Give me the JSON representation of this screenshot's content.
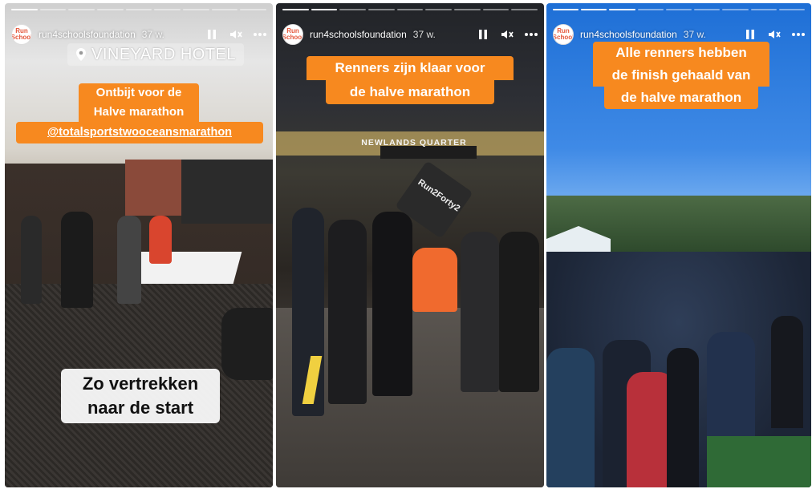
{
  "colors": {
    "caption_bg": "#f7891f",
    "caption_text": "#ffffff",
    "progress_active": "#ffffff"
  },
  "stories": [
    {
      "username": "run4schoolsfoundation",
      "time_ago": "37 w.",
      "avatar_text": "Run 4Schools",
      "progress": {
        "total": 9,
        "current": 1
      },
      "location_sticker": "VINEYARD HOTEL",
      "caption_lines": [
        "Ontbijt voor de",
        "Halve marathon",
        "@totalsportstwooceansmarathon"
      ],
      "bottom_caption_lines": [
        "Zo vertrekken",
        "naar de start"
      ],
      "icons": [
        "pause-icon",
        "volume-muted-icon",
        "more-icon"
      ]
    },
    {
      "username": "run4schoolsfoundation",
      "time_ago": "37 w.",
      "avatar_text": "Run 4Schools",
      "progress": {
        "total": 9,
        "current": 2
      },
      "caption_lines": [
        "Renners zijn klaar voor",
        "de halve marathon"
      ],
      "sign_text": "NEWLANDS QUARTER",
      "banner_text": "Run2Forty2",
      "icons": [
        "pause-icon",
        "volume-muted-icon",
        "more-icon"
      ]
    },
    {
      "username": "run4schoolsfoundation",
      "time_ago": "37 w.",
      "avatar_text": "Run 4Schools",
      "progress": {
        "total": 9,
        "current": 3
      },
      "caption_lines": [
        "Alle renners hebben",
        "de finish gehaald van",
        "de halve marathon"
      ],
      "icons": [
        "pause-icon",
        "volume-muted-icon",
        "more-icon"
      ]
    }
  ]
}
